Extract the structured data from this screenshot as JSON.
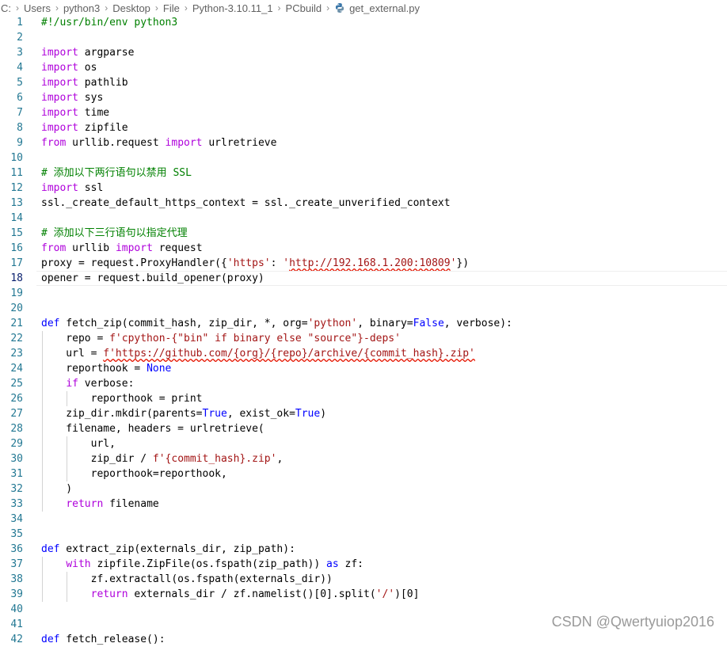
{
  "breadcrumb": {
    "segments": [
      "C:",
      "Users",
      "python3",
      "Desktop",
      "File",
      "Python-3.10.11_1",
      "PCbuild"
    ],
    "separator": "›",
    "file": "get_external.py",
    "file_icon": "python-file-icon"
  },
  "editor": {
    "current_line": 18,
    "lines": [
      {
        "n": "1",
        "t": "#!/usr/bin/env python3"
      },
      {
        "n": "2",
        "t": ""
      },
      {
        "n": "3",
        "t": "import argparse"
      },
      {
        "n": "4",
        "t": "import os"
      },
      {
        "n": "5",
        "t": "import pathlib"
      },
      {
        "n": "6",
        "t": "import sys"
      },
      {
        "n": "7",
        "t": "import time"
      },
      {
        "n": "8",
        "t": "import zipfile"
      },
      {
        "n": "9",
        "t": "from urllib.request import urlretrieve"
      },
      {
        "n": "10",
        "t": ""
      },
      {
        "n": "11",
        "t": "# 添加以下两行语句以禁用 SSL"
      },
      {
        "n": "12",
        "t": "import ssl"
      },
      {
        "n": "13",
        "t": "ssl._create_default_https_context = ssl._create_unverified_context"
      },
      {
        "n": "14",
        "t": ""
      },
      {
        "n": "15",
        "t": "# 添加以下三行语句以指定代理"
      },
      {
        "n": "16",
        "t": "from urllib import request"
      },
      {
        "n": "17",
        "t": "proxy = request.ProxyHandler({'https': 'http://192.168.1.200:10809'})"
      },
      {
        "n": "18",
        "t": "opener = request.build_opener(proxy)"
      },
      {
        "n": "19",
        "t": ""
      },
      {
        "n": "20",
        "t": ""
      },
      {
        "n": "21",
        "t": "def fetch_zip(commit_hash, zip_dir, *, org='python', binary=False, verbose):"
      },
      {
        "n": "22",
        "t": "    repo = f'cpython-{\"bin\" if binary else \"source\"}-deps'"
      },
      {
        "n": "23",
        "t": "    url = f'https://github.com/{org}/{repo}/archive/{commit_hash}.zip'"
      },
      {
        "n": "24",
        "t": "    reporthook = None"
      },
      {
        "n": "25",
        "t": "    if verbose:"
      },
      {
        "n": "26",
        "t": "        reporthook = print"
      },
      {
        "n": "27",
        "t": "    zip_dir.mkdir(parents=True, exist_ok=True)"
      },
      {
        "n": "28",
        "t": "    filename, headers = urlretrieve("
      },
      {
        "n": "29",
        "t": "        url,"
      },
      {
        "n": "30",
        "t": "        zip_dir / f'{commit_hash}.zip',"
      },
      {
        "n": "31",
        "t": "        reporthook=reporthook,"
      },
      {
        "n": "32",
        "t": "    )"
      },
      {
        "n": "33",
        "t": "    return filename"
      },
      {
        "n": "34",
        "t": ""
      },
      {
        "n": "35",
        "t": ""
      },
      {
        "n": "36",
        "t": "def extract_zip(externals_dir, zip_path):"
      },
      {
        "n": "37",
        "t": "    with zipfile.ZipFile(os.fspath(zip_path)) as zf:"
      },
      {
        "n": "38",
        "t": "        zf.extractall(os.fspath(externals_dir))"
      },
      {
        "n": "39",
        "t": "        return externals_dir / zf.namelist()[0].split('/')[0]"
      },
      {
        "n": "40",
        "t": ""
      },
      {
        "n": "41",
        "t": ""
      },
      {
        "n": "42",
        "t": "def fetch_release():"
      }
    ]
  },
  "watermark": "CSDN @Qwertyuiop2016",
  "colors": {
    "keyword": "#0000ff",
    "control": "#af00db",
    "comment": "#008000",
    "string": "#a31515",
    "line_number": "#237893"
  }
}
